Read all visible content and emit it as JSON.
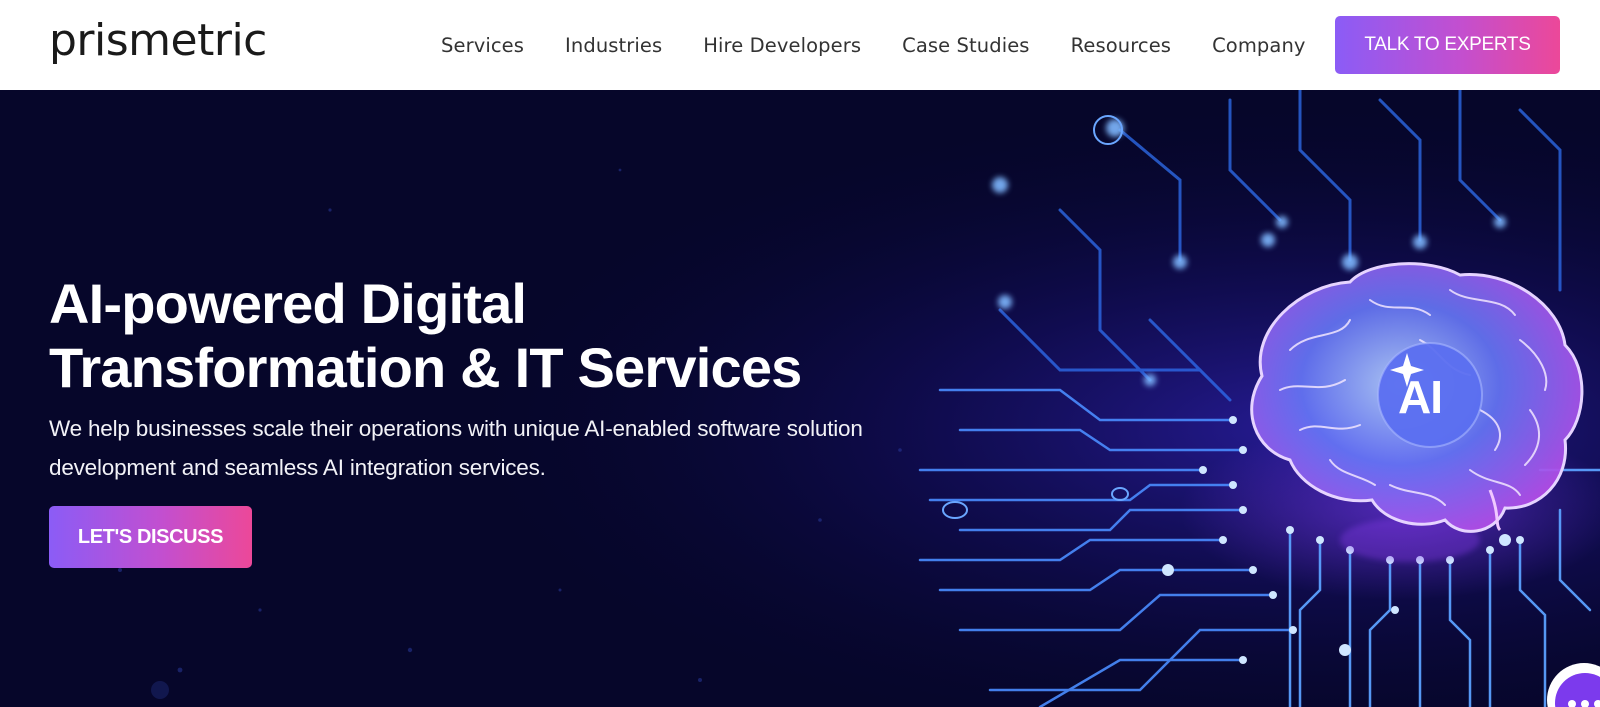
{
  "brand": {
    "logo_text": "prismetric"
  },
  "nav": {
    "items": [
      "Services",
      "Industries",
      "Hire Developers",
      "Case Studies",
      "Resources",
      "Company"
    ],
    "cta_label": "TALK TO EXPERTS"
  },
  "hero": {
    "title_line1": "AI-powered Digital",
    "title_line2": "Transformation & IT Services",
    "subtitle": "We help businesses scale their operations with unique AI-enabled software solution development and seamless AI integration services.",
    "cta_label": "LET'S DISCUSS",
    "badge_text": "AI"
  },
  "colors": {
    "hero_bg": "#06062a",
    "accent_start": "#8b5cf6",
    "accent_end": "#ec4899",
    "circuit": "#3b82f6"
  },
  "icons": {
    "chat": "chat-bubble-icon",
    "sparkle": "sparkle-icon"
  }
}
